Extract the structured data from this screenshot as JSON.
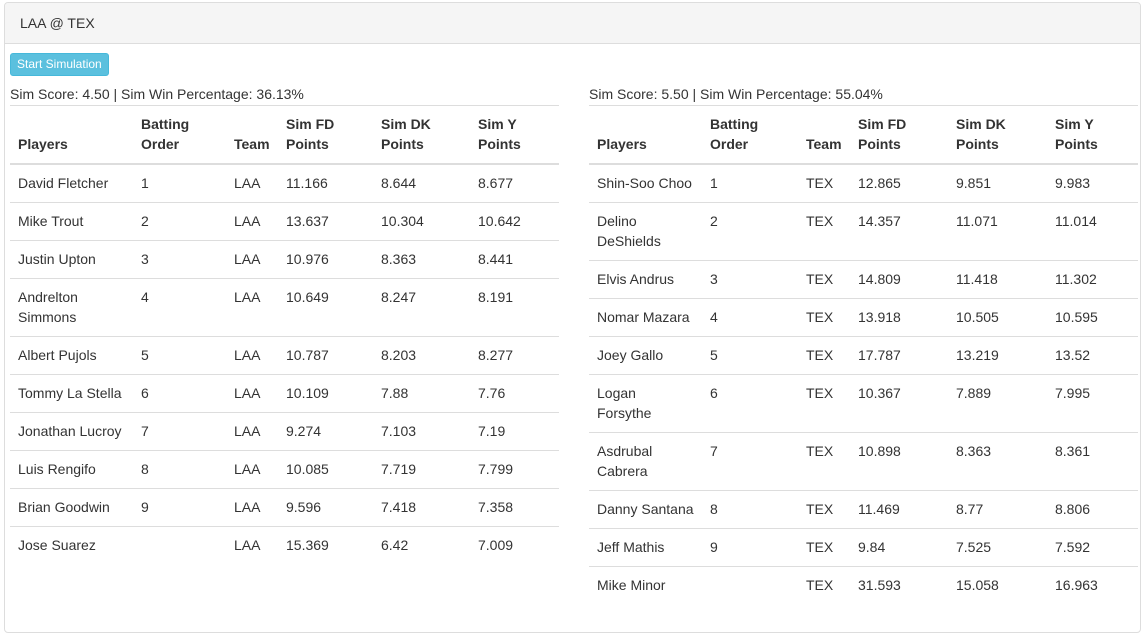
{
  "panel": {
    "title": "LAA @ TEX"
  },
  "toolbar": {
    "start_label": "Start Simulation"
  },
  "columns": [
    "Players",
    "Batting Order",
    "Team",
    "Sim FD Points",
    "Sim DK Points",
    "Sim Y Points"
  ],
  "teams": [
    {
      "summary": "Sim Score: 4.50 | Sim Win Percentage: 36.13%",
      "rows": [
        {
          "player": "David Fletcher",
          "order": "1",
          "team": "LAA",
          "fd": "11.166",
          "dk": "8.644",
          "y": "8.677"
        },
        {
          "player": "Mike Trout",
          "order": "2",
          "team": "LAA",
          "fd": "13.637",
          "dk": "10.304",
          "y": "10.642"
        },
        {
          "player": "Justin Upton",
          "order": "3",
          "team": "LAA",
          "fd": "10.976",
          "dk": "8.363",
          "y": "8.441"
        },
        {
          "player": "Andrelton Simmons",
          "order": "4",
          "team": "LAA",
          "fd": "10.649",
          "dk": "8.247",
          "y": "8.191"
        },
        {
          "player": "Albert Pujols",
          "order": "5",
          "team": "LAA",
          "fd": "10.787",
          "dk": "8.203",
          "y": "8.277"
        },
        {
          "player": "Tommy La Stella",
          "order": "6",
          "team": "LAA",
          "fd": "10.109",
          "dk": "7.88",
          "y": "7.76"
        },
        {
          "player": "Jonathan Lucroy",
          "order": "7",
          "team": "LAA",
          "fd": "9.274",
          "dk": "7.103",
          "y": "7.19"
        },
        {
          "player": "Luis Rengifo",
          "order": "8",
          "team": "LAA",
          "fd": "10.085",
          "dk": "7.719",
          "y": "7.799"
        },
        {
          "player": "Brian Goodwin",
          "order": "9",
          "team": "LAA",
          "fd": "9.596",
          "dk": "7.418",
          "y": "7.358"
        },
        {
          "player": "Jose Suarez",
          "order": "",
          "team": "LAA",
          "fd": "15.369",
          "dk": "6.42",
          "y": "7.009"
        }
      ]
    },
    {
      "summary": "Sim Score: 5.50 | Sim Win Percentage: 55.04%",
      "rows": [
        {
          "player": "Shin-Soo Choo",
          "order": "1",
          "team": "TEX",
          "fd": "12.865",
          "dk": "9.851",
          "y": "9.983"
        },
        {
          "player": "Delino DeShields",
          "order": "2",
          "team": "TEX",
          "fd": "14.357",
          "dk": "11.071",
          "y": "11.014"
        },
        {
          "player": "Elvis Andrus",
          "order": "3",
          "team": "TEX",
          "fd": "14.809",
          "dk": "11.418",
          "y": "11.302"
        },
        {
          "player": "Nomar Mazara",
          "order": "4",
          "team": "TEX",
          "fd": "13.918",
          "dk": "10.505",
          "y": "10.595"
        },
        {
          "player": "Joey Gallo",
          "order": "5",
          "team": "TEX",
          "fd": "17.787",
          "dk": "13.219",
          "y": "13.52"
        },
        {
          "player": "Logan Forsythe",
          "order": "6",
          "team": "TEX",
          "fd": "10.367",
          "dk": "7.889",
          "y": "7.995"
        },
        {
          "player": "Asdrubal Cabrera",
          "order": "7",
          "team": "TEX",
          "fd": "10.898",
          "dk": "8.363",
          "y": "8.361"
        },
        {
          "player": "Danny Santana",
          "order": "8",
          "team": "TEX",
          "fd": "11.469",
          "dk": "8.77",
          "y": "8.806"
        },
        {
          "player": "Jeff Mathis",
          "order": "9",
          "team": "TEX",
          "fd": "9.84",
          "dk": "7.525",
          "y": "7.592"
        },
        {
          "player": "Mike Minor",
          "order": "",
          "team": "TEX",
          "fd": "31.593",
          "dk": "15.058",
          "y": "16.963"
        }
      ]
    }
  ]
}
